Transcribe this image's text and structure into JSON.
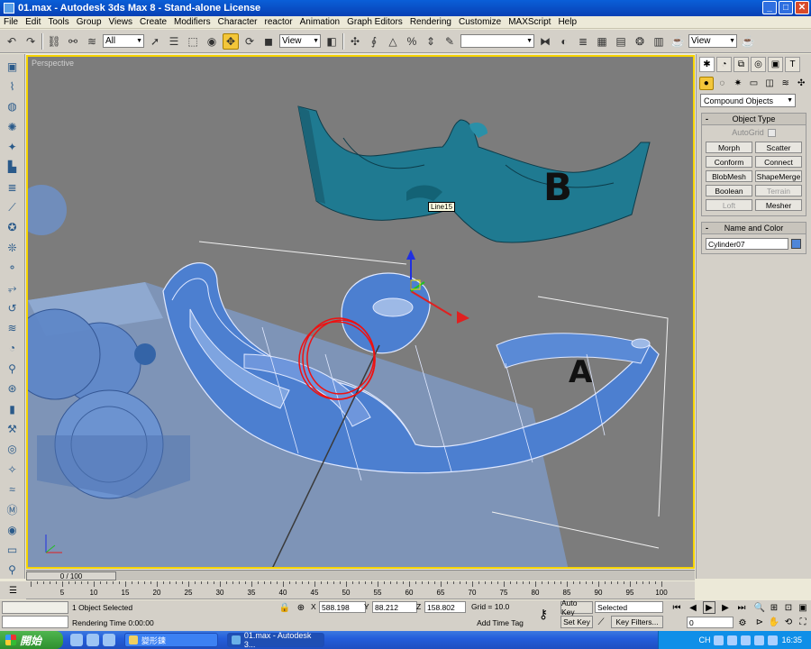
{
  "window": {
    "title": "01.max - Autodesk 3ds Max 8 - Stand-alone License",
    "min": "_",
    "max": "□",
    "close": "✕"
  },
  "menu": [
    "File",
    "Edit",
    "Tools",
    "Group",
    "Views",
    "Create",
    "Modifiers",
    "Character",
    "reactor",
    "Animation",
    "Graph Editors",
    "Rendering",
    "Customize",
    "MAXScript",
    "Help"
  ],
  "toolbar": {
    "selection_filter": "All",
    "reference_coord": "View",
    "named_selection": "",
    "render_view": "View"
  },
  "viewport": {
    "label": "Perspective",
    "tooltip": "Line15",
    "annotation_a": "A",
    "annotation_b": "B"
  },
  "command_panel": {
    "category": "Compound Objects",
    "object_type_title": "Object Type",
    "autogrid_label": "AutoGrid",
    "buttons": [
      "Morph",
      "Scatter",
      "Conform",
      "Connect",
      "BlobMesh",
      "ShapeMerge",
      "Boolean",
      "Terrain",
      "Loft",
      "Mesher"
    ],
    "name_color_title": "Name and Color",
    "object_name": "Cylinder07",
    "object_color": "#4f86d8"
  },
  "timeline": {
    "slider_label": "0 / 100",
    "ticks": [
      "5",
      "10",
      "15",
      "20",
      "25",
      "30",
      "35",
      "40",
      "45",
      "50",
      "55",
      "60",
      "65",
      "70",
      "75",
      "80",
      "85",
      "90",
      "95",
      "100"
    ]
  },
  "status": {
    "selection": "1 Object Selected",
    "prompt": "Rendering Time  0:00:00",
    "x_label": "X",
    "x": "588.198",
    "y_label": "Y",
    "y": "88.212",
    "z_label": "Z",
    "z": "158.802",
    "grid": "Grid = 10.0",
    "add_time_tag": "Add Time Tag",
    "auto_key": "Auto Key",
    "set_key": "Set Key",
    "key_mode": "Selected",
    "key_filters": "Key Filters...",
    "frame": "0"
  },
  "taskbar": {
    "start": "開始",
    "task_folder": "變形鍊",
    "task_app": "01.max - Autodesk 3...",
    "lang": "CH",
    "clock": "16:35"
  }
}
